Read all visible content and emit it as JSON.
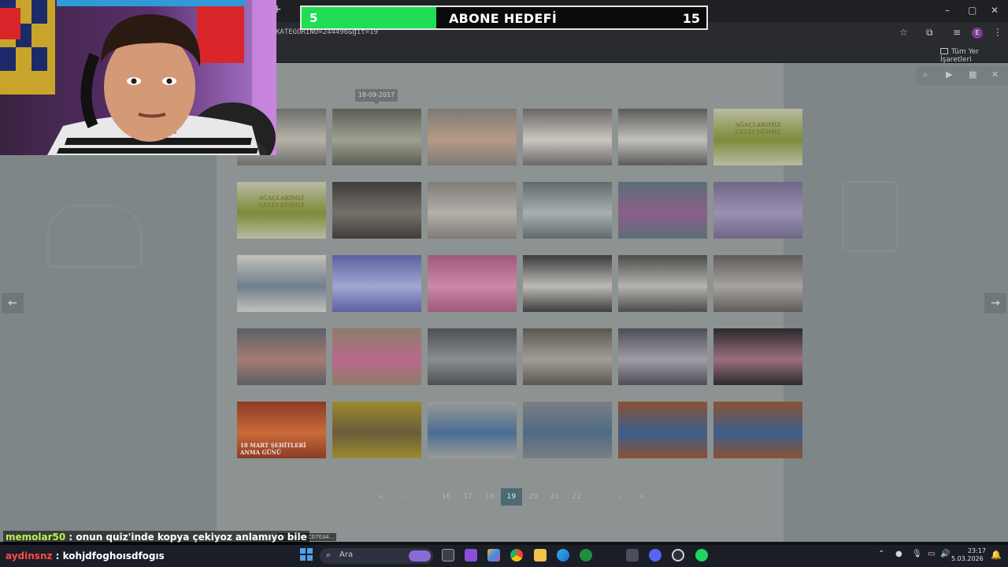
{
  "browser": {
    "new_tab": "+",
    "url": "KATEGORINO=244496&git=19",
    "bookmarks_label": "Tüm Yer İşaretleri",
    "profile_letter": "E",
    "window_controls": [
      "–",
      "▢",
      "✕"
    ]
  },
  "goal": {
    "current": "5",
    "title": "ABONE HEDEFİ",
    "target": "15",
    "progress_fraction": 0.3333,
    "fill_color": "#1fdd55"
  },
  "gallery": {
    "tooltip": "18-09-2017",
    "thumbs": [
      {
        "caption": "",
        "color": "#6d6e6a",
        "accent": "#b7b2a8"
      },
      {
        "caption": "",
        "color": "#5a5f55",
        "accent": "#9ea08f"
      },
      {
        "caption": "",
        "color": "#7d7a74",
        "accent": "#b79a86"
      },
      {
        "caption": "",
        "color": "#6a6765",
        "accent": "#c9c6c0"
      },
      {
        "caption": "",
        "color": "#5c5b5a",
        "accent": "#c2c0bc"
      },
      {
        "caption": "AĞAÇLARIMIZ GELECEĞİMİZ",
        "color": "#b9bba2",
        "accent": "#7c8b3a",
        "poster": true
      },
      {
        "caption": "AĞAÇLARIMIZ GELECEĞİMİZ",
        "color": "#b9bba2",
        "accent": "#7c8b3a",
        "poster": true
      },
      {
        "caption": "",
        "color": "#3f3d3a",
        "accent": "#75706a"
      },
      {
        "caption": "",
        "color": "#7f7b77",
        "accent": "#b3b0aa"
      },
      {
        "caption": "",
        "color": "#5f6a6c",
        "accent": "#a8b0af"
      },
      {
        "caption": "",
        "color": "#5d6e78",
        "accent": "#8c5e8a"
      },
      {
        "caption": "",
        "color": "#6e6788",
        "accent": "#9c8fb3"
      },
      {
        "caption": "",
        "color": "#c3c2bb",
        "accent": "#6f7e8e"
      },
      {
        "caption": "",
        "color": "#5c60a0",
        "accent": "#a2a6d1"
      },
      {
        "caption": "",
        "color": "#a0587a",
        "accent": "#c98aa6"
      },
      {
        "caption": "",
        "color": "#3d3c3c",
        "accent": "#bcbab6"
      },
      {
        "caption": "",
        "color": "#4c4c4b",
        "accent": "#b5b3ae"
      },
      {
        "caption": "",
        "color": "#5f5b58",
        "accent": "#a7a39e"
      },
      {
        "caption": "",
        "color": "#5b6066",
        "accent": "#a57b74"
      },
      {
        "caption": "",
        "color": "#8d7d68",
        "accent": "#b96a8c"
      },
      {
        "caption": "",
        "color": "#4d5052",
        "accent": "#8b8e90"
      },
      {
        "caption": "",
        "color": "#5a5650",
        "accent": "#a29d96"
      },
      {
        "caption": "",
        "color": "#4d4e55",
        "accent": "#9d9da6"
      },
      {
        "caption": "",
        "color": "#2b2a2c",
        "accent": "#9a6f7f"
      },
      {
        "caption": "18 MART ŞEHİTLERİ ANMA GÜNÜ",
        "color": "#8c3b26",
        "accent": "#c96a3a"
      },
      {
        "caption": "",
        "color": "#9b8a2e",
        "accent": "#6a5d3a"
      },
      {
        "caption": "",
        "color": "#9b9a96",
        "accent": "#4a6d93"
      },
      {
        "caption": "",
        "color": "#7a7e82",
        "accent": "#4f6b86"
      },
      {
        "caption": "",
        "color": "#8c5234",
        "accent": "#3a5f8d"
      },
      {
        "caption": "",
        "color": "#8c5234",
        "accent": "#3a5f8d"
      }
    ]
  },
  "pager": {
    "items": [
      "«",
      "‹",
      "...",
      "16",
      "17",
      "18",
      "19",
      "20",
      "21",
      "22",
      "...",
      "›",
      "»"
    ],
    "active": "19"
  },
  "lightbox": {
    "tools": [
      "⌕",
      "▶",
      "▦",
      "✕"
    ],
    "prev": "←",
    "next": "→"
  },
  "filestrip": "13106_DSC07034...",
  "chat": [
    {
      "user": "memolar50",
      "message": " : onun quiz'inde kopya çekiyoz anlamıyo bile",
      "color": "#b9f24c"
    },
    {
      "user": "aydinsnz",
      "message": " : kohjdfoghoısdfogıs",
      "color": "#ff4a4a"
    }
  ],
  "taskbar": {
    "search_placeholder": "Ara",
    "time": "23:17",
    "date": "5.03.2026"
  }
}
